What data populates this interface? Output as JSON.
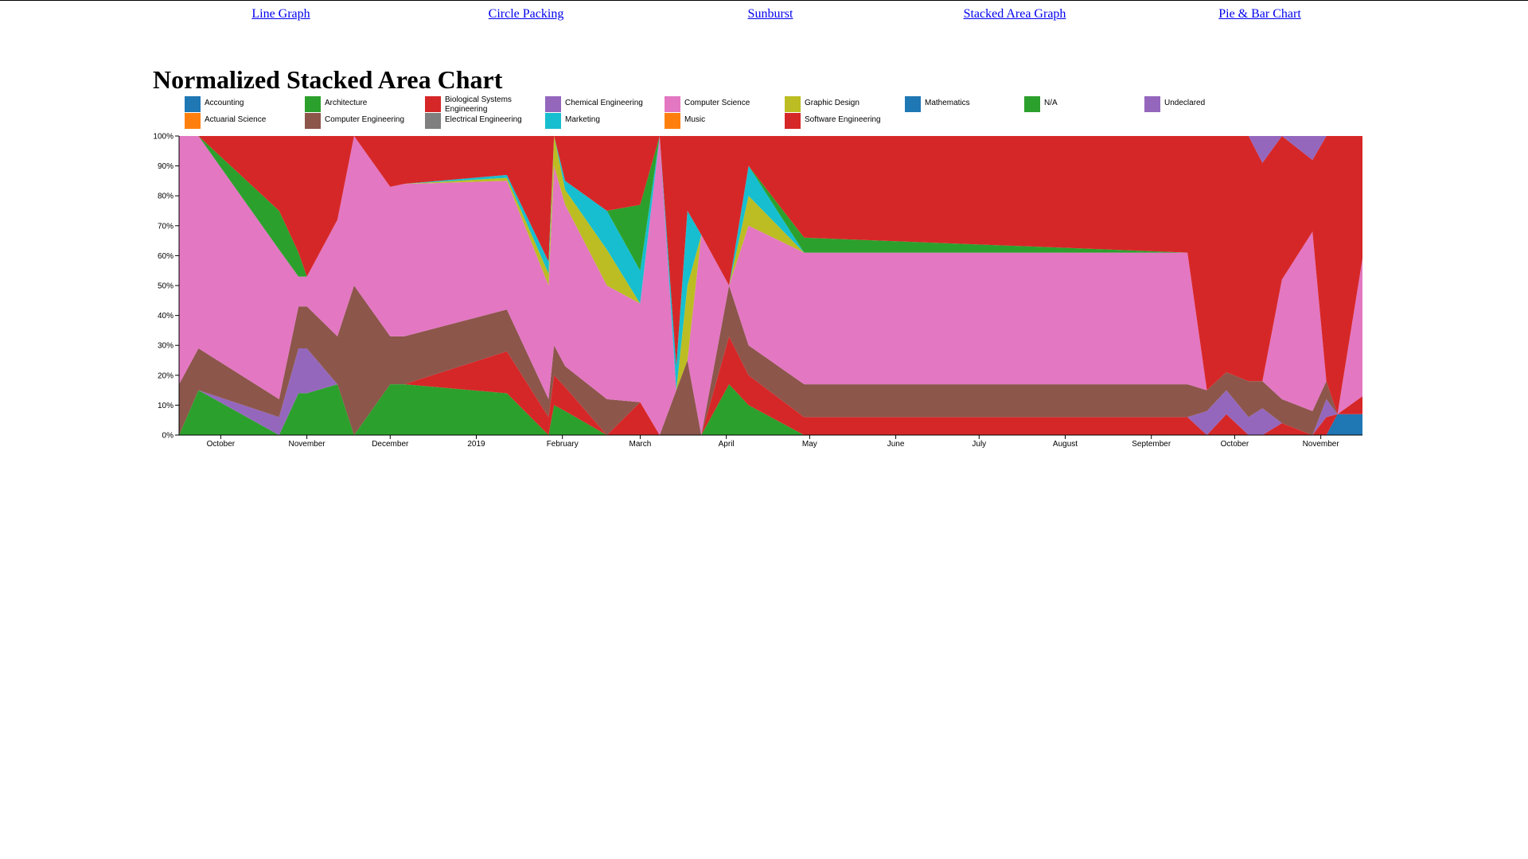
{
  "nav": {
    "links": [
      {
        "label": "Line Graph"
      },
      {
        "label": "Circle Packing"
      },
      {
        "label": "Sunburst"
      },
      {
        "label": "Stacked Area Graph"
      },
      {
        "label": "Pie & Bar Chart"
      }
    ]
  },
  "chart_data": {
    "type": "area",
    "title": "Normalized Stacked Area Chart",
    "xlabel": "",
    "ylabel": "",
    "stacked": true,
    "normalized": true,
    "ylim": [
      0,
      100
    ],
    "y_ticks": [
      "0%",
      "10%",
      "20%",
      "30%",
      "40%",
      "50%",
      "60%",
      "70%",
      "80%",
      "90%",
      "100%"
    ],
    "x_ticks": [
      "October",
      "November",
      "December",
      "2019",
      "February",
      "March",
      "April",
      "May",
      "June",
      "July",
      "August",
      "September",
      "October",
      "November"
    ],
    "x_tick_dates": [
      "2018-10-01",
      "2018-11-01",
      "2018-12-01",
      "2019-01-01",
      "2019-02-01",
      "2019-03-01",
      "2019-04-01",
      "2019-05-01",
      "2019-06-01",
      "2019-07-01",
      "2019-08-01",
      "2019-09-01",
      "2019-10-01",
      "2019-11-01"
    ],
    "xlim": [
      "2018-09-16",
      "2019-11-16"
    ],
    "legend_position": "top",
    "series_colors": {
      "Accounting": "#1f77b4",
      "Actuarial Science": "#ff7f0e",
      "Architecture": "#2ca02c",
      "Biological Systems Engineering": "#d62728",
      "Chemical Engineering": "#9467bd",
      "Computer Engineering": "#8c564b",
      "Computer Science": "#e377c2",
      "Electrical Engineering": "#7f7f7f",
      "Graphic Design": "#bcbd22",
      "Marketing": "#17becf",
      "Mathematics": "#1f77b4",
      "Music": "#ff7f0e",
      "N/A": "#2ca02c",
      "Software Engineering": "#d62728",
      "Undeclared": "#9467bd"
    },
    "legend": [
      "Accounting",
      "Architecture",
      "Biological Systems Engineering",
      "Chemical Engineering",
      "Computer Science",
      "Graphic Design",
      "Mathematics",
      "N/A",
      "Undeclared",
      "Actuarial Science",
      "Computer Engineering",
      "Electrical Engineering",
      "Marketing",
      "Music",
      "Software Engineering"
    ],
    "x": [
      "2018-09-16",
      "2018-09-23",
      "2018-10-22",
      "2018-10-29",
      "2018-11-01",
      "2018-11-12",
      "2018-11-18",
      "2018-12-01",
      "2018-12-06",
      "2019-01-12",
      "2019-01-27",
      "2019-01-29",
      "2019-02-02",
      "2019-02-17",
      "2019-02-29",
      "2019-03-08",
      "2019-03-14",
      "2019-03-18",
      "2019-03-23",
      "2019-04-02",
      "2019-04-09",
      "2019-04-29",
      "2019-09-14",
      "2019-09-21",
      "2019-09-28",
      "2019-10-06",
      "2019-10-11",
      "2019-10-18",
      "2019-10-29",
      "2019-11-03",
      "2019-11-07",
      "2019-11-16"
    ],
    "series": [
      {
        "name": "Accounting",
        "values": [
          0,
          0,
          0,
          0,
          0,
          0,
          0,
          0,
          0,
          0,
          0,
          0,
          0,
          0,
          0,
          0,
          0,
          0,
          0,
          0,
          0,
          0,
          0,
          0,
          0,
          0,
          0,
          0,
          0,
          0,
          7,
          7
        ]
      },
      {
        "name": "Architecture",
        "values": [
          0,
          15,
          0,
          14,
          14,
          17,
          0,
          17,
          17,
          14,
          0,
          10,
          8,
          0,
          0,
          0,
          0,
          0,
          0,
          17,
          10,
          0,
          0,
          0,
          0,
          0,
          0,
          0,
          0,
          0,
          0,
          0
        ]
      },
      {
        "name": "Biological Systems Engineering",
        "values": [
          0,
          0,
          0,
          0,
          0,
          0,
          0,
          0,
          0,
          14,
          6,
          10,
          8,
          0,
          11,
          0,
          0,
          0,
          0,
          16,
          10,
          6,
          6,
          0,
          7,
          0,
          0,
          4,
          0,
          6,
          0,
          6
        ]
      },
      {
        "name": "Chemical Engineering",
        "values": [
          0,
          0,
          6,
          15,
          15,
          0,
          0,
          0,
          0,
          0,
          0,
          0,
          0,
          0,
          0,
          0,
          0,
          0,
          0,
          0,
          0,
          0,
          0,
          8,
          8,
          6,
          9,
          0,
          0,
          6,
          0,
          0
        ]
      },
      {
        "name": "Computer Engineering",
        "values": [
          17,
          14,
          6,
          14,
          14,
          16,
          50,
          16,
          16,
          14,
          6,
          10,
          7,
          12,
          0,
          0,
          15,
          25,
          0,
          17,
          10,
          11,
          11,
          7,
          6,
          12,
          9,
          8,
          8,
          6,
          0,
          0
        ]
      },
      {
        "name": "Computer Science",
        "values": [
          83,
          71,
          50,
          10,
          10,
          39,
          50,
          50,
          51,
          43,
          38,
          60,
          54,
          38,
          33,
          100,
          0,
          0,
          67,
          0,
          40,
          44,
          44,
          0,
          0,
          0,
          0,
          40,
          60,
          0,
          0,
          46
        ]
      },
      {
        "name": "Graphic Design",
        "values": [
          0,
          0,
          0,
          0,
          0,
          0,
          0,
          0,
          0,
          1,
          4,
          10,
          5,
          12,
          0,
          0,
          0,
          25,
          0,
          0,
          10,
          0,
          0,
          0,
          0,
          0,
          0,
          0,
          0,
          0,
          0,
          0
        ]
      },
      {
        "name": "Marketing",
        "values": [
          0,
          0,
          0,
          0,
          0,
          0,
          0,
          0,
          0,
          1,
          4,
          0,
          3,
          13,
          11,
          0,
          8,
          25,
          0,
          0,
          10,
          0,
          0,
          0,
          0,
          0,
          0,
          0,
          0,
          0,
          0,
          0
        ]
      },
      {
        "name": "N/A",
        "values": [
          0,
          0,
          13,
          8,
          0,
          0,
          0,
          0,
          0,
          0,
          0,
          0,
          0,
          0,
          22,
          0,
          0,
          0,
          0,
          0,
          0,
          5,
          0,
          0,
          0,
          0,
          0,
          0,
          0,
          0,
          0,
          0
        ]
      },
      {
        "name": "Software Engineering",
        "values": [
          0,
          0,
          25,
          39,
          47,
          28,
          0,
          17,
          16,
          13,
          42,
          0,
          15,
          25,
          23,
          0,
          77,
          25,
          33,
          50,
          10,
          34,
          39,
          85,
          79,
          82,
          73,
          48,
          24,
          82,
          93,
          41
        ]
      },
      {
        "name": "Undeclared",
        "values": [
          0,
          0,
          0,
          0,
          0,
          0,
          0,
          0,
          0,
          0,
          0,
          0,
          0,
          0,
          0,
          0,
          0,
          0,
          0,
          0,
          0,
          0,
          0,
          0,
          0,
          0,
          9,
          0,
          8,
          0,
          0,
          0
        ]
      }
    ]
  }
}
